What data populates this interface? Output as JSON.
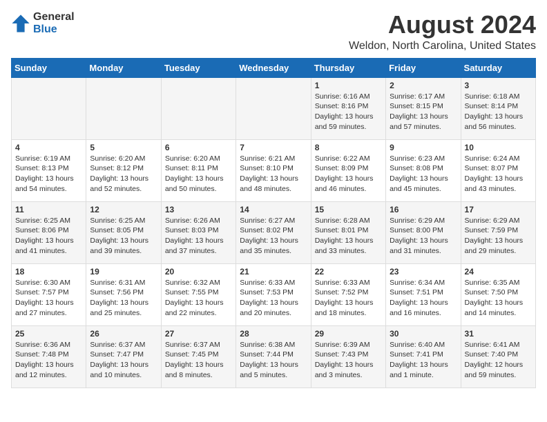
{
  "header": {
    "logo_general": "General",
    "logo_blue": "Blue",
    "month_title": "August 2024",
    "location": "Weldon, North Carolina, United States"
  },
  "days_of_week": [
    "Sunday",
    "Monday",
    "Tuesday",
    "Wednesday",
    "Thursday",
    "Friday",
    "Saturday"
  ],
  "weeks": [
    [
      {
        "day": "",
        "sunrise": "",
        "sunset": "",
        "daylight": ""
      },
      {
        "day": "",
        "sunrise": "",
        "sunset": "",
        "daylight": ""
      },
      {
        "day": "",
        "sunrise": "",
        "sunset": "",
        "daylight": ""
      },
      {
        "day": "",
        "sunrise": "",
        "sunset": "",
        "daylight": ""
      },
      {
        "day": "1",
        "sunrise": "Sunrise: 6:16 AM",
        "sunset": "Sunset: 8:16 PM",
        "daylight": "Daylight: 13 hours and 59 minutes."
      },
      {
        "day": "2",
        "sunrise": "Sunrise: 6:17 AM",
        "sunset": "Sunset: 8:15 PM",
        "daylight": "Daylight: 13 hours and 57 minutes."
      },
      {
        "day": "3",
        "sunrise": "Sunrise: 6:18 AM",
        "sunset": "Sunset: 8:14 PM",
        "daylight": "Daylight: 13 hours and 56 minutes."
      }
    ],
    [
      {
        "day": "4",
        "sunrise": "Sunrise: 6:19 AM",
        "sunset": "Sunset: 8:13 PM",
        "daylight": "Daylight: 13 hours and 54 minutes."
      },
      {
        "day": "5",
        "sunrise": "Sunrise: 6:20 AM",
        "sunset": "Sunset: 8:12 PM",
        "daylight": "Daylight: 13 hours and 52 minutes."
      },
      {
        "day": "6",
        "sunrise": "Sunrise: 6:20 AM",
        "sunset": "Sunset: 8:11 PM",
        "daylight": "Daylight: 13 hours and 50 minutes."
      },
      {
        "day": "7",
        "sunrise": "Sunrise: 6:21 AM",
        "sunset": "Sunset: 8:10 PM",
        "daylight": "Daylight: 13 hours and 48 minutes."
      },
      {
        "day": "8",
        "sunrise": "Sunrise: 6:22 AM",
        "sunset": "Sunset: 8:09 PM",
        "daylight": "Daylight: 13 hours and 46 minutes."
      },
      {
        "day": "9",
        "sunrise": "Sunrise: 6:23 AM",
        "sunset": "Sunset: 8:08 PM",
        "daylight": "Daylight: 13 hours and 45 minutes."
      },
      {
        "day": "10",
        "sunrise": "Sunrise: 6:24 AM",
        "sunset": "Sunset: 8:07 PM",
        "daylight": "Daylight: 13 hours and 43 minutes."
      }
    ],
    [
      {
        "day": "11",
        "sunrise": "Sunrise: 6:25 AM",
        "sunset": "Sunset: 8:06 PM",
        "daylight": "Daylight: 13 hours and 41 minutes."
      },
      {
        "day": "12",
        "sunrise": "Sunrise: 6:25 AM",
        "sunset": "Sunset: 8:05 PM",
        "daylight": "Daylight: 13 hours and 39 minutes."
      },
      {
        "day": "13",
        "sunrise": "Sunrise: 6:26 AM",
        "sunset": "Sunset: 8:03 PM",
        "daylight": "Daylight: 13 hours and 37 minutes."
      },
      {
        "day": "14",
        "sunrise": "Sunrise: 6:27 AM",
        "sunset": "Sunset: 8:02 PM",
        "daylight": "Daylight: 13 hours and 35 minutes."
      },
      {
        "day": "15",
        "sunrise": "Sunrise: 6:28 AM",
        "sunset": "Sunset: 8:01 PM",
        "daylight": "Daylight: 13 hours and 33 minutes."
      },
      {
        "day": "16",
        "sunrise": "Sunrise: 6:29 AM",
        "sunset": "Sunset: 8:00 PM",
        "daylight": "Daylight: 13 hours and 31 minutes."
      },
      {
        "day": "17",
        "sunrise": "Sunrise: 6:29 AM",
        "sunset": "Sunset: 7:59 PM",
        "daylight": "Daylight: 13 hours and 29 minutes."
      }
    ],
    [
      {
        "day": "18",
        "sunrise": "Sunrise: 6:30 AM",
        "sunset": "Sunset: 7:57 PM",
        "daylight": "Daylight: 13 hours and 27 minutes."
      },
      {
        "day": "19",
        "sunrise": "Sunrise: 6:31 AM",
        "sunset": "Sunset: 7:56 PM",
        "daylight": "Daylight: 13 hours and 25 minutes."
      },
      {
        "day": "20",
        "sunrise": "Sunrise: 6:32 AM",
        "sunset": "Sunset: 7:55 PM",
        "daylight": "Daylight: 13 hours and 22 minutes."
      },
      {
        "day": "21",
        "sunrise": "Sunrise: 6:33 AM",
        "sunset": "Sunset: 7:53 PM",
        "daylight": "Daylight: 13 hours and 20 minutes."
      },
      {
        "day": "22",
        "sunrise": "Sunrise: 6:33 AM",
        "sunset": "Sunset: 7:52 PM",
        "daylight": "Daylight: 13 hours and 18 minutes."
      },
      {
        "day": "23",
        "sunrise": "Sunrise: 6:34 AM",
        "sunset": "Sunset: 7:51 PM",
        "daylight": "Daylight: 13 hours and 16 minutes."
      },
      {
        "day": "24",
        "sunrise": "Sunrise: 6:35 AM",
        "sunset": "Sunset: 7:50 PM",
        "daylight": "Daylight: 13 hours and 14 minutes."
      }
    ],
    [
      {
        "day": "25",
        "sunrise": "Sunrise: 6:36 AM",
        "sunset": "Sunset: 7:48 PM",
        "daylight": "Daylight: 13 hours and 12 minutes."
      },
      {
        "day": "26",
        "sunrise": "Sunrise: 6:37 AM",
        "sunset": "Sunset: 7:47 PM",
        "daylight": "Daylight: 13 hours and 10 minutes."
      },
      {
        "day": "27",
        "sunrise": "Sunrise: 6:37 AM",
        "sunset": "Sunset: 7:45 PM",
        "daylight": "Daylight: 13 hours and 8 minutes."
      },
      {
        "day": "28",
        "sunrise": "Sunrise: 6:38 AM",
        "sunset": "Sunset: 7:44 PM",
        "daylight": "Daylight: 13 hours and 5 minutes."
      },
      {
        "day": "29",
        "sunrise": "Sunrise: 6:39 AM",
        "sunset": "Sunset: 7:43 PM",
        "daylight": "Daylight: 13 hours and 3 minutes."
      },
      {
        "day": "30",
        "sunrise": "Sunrise: 6:40 AM",
        "sunset": "Sunset: 7:41 PM",
        "daylight": "Daylight: 13 hours and 1 minute."
      },
      {
        "day": "31",
        "sunrise": "Sunrise: 6:41 AM",
        "sunset": "Sunset: 7:40 PM",
        "daylight": "Daylight: 12 hours and 59 minutes."
      }
    ]
  ]
}
